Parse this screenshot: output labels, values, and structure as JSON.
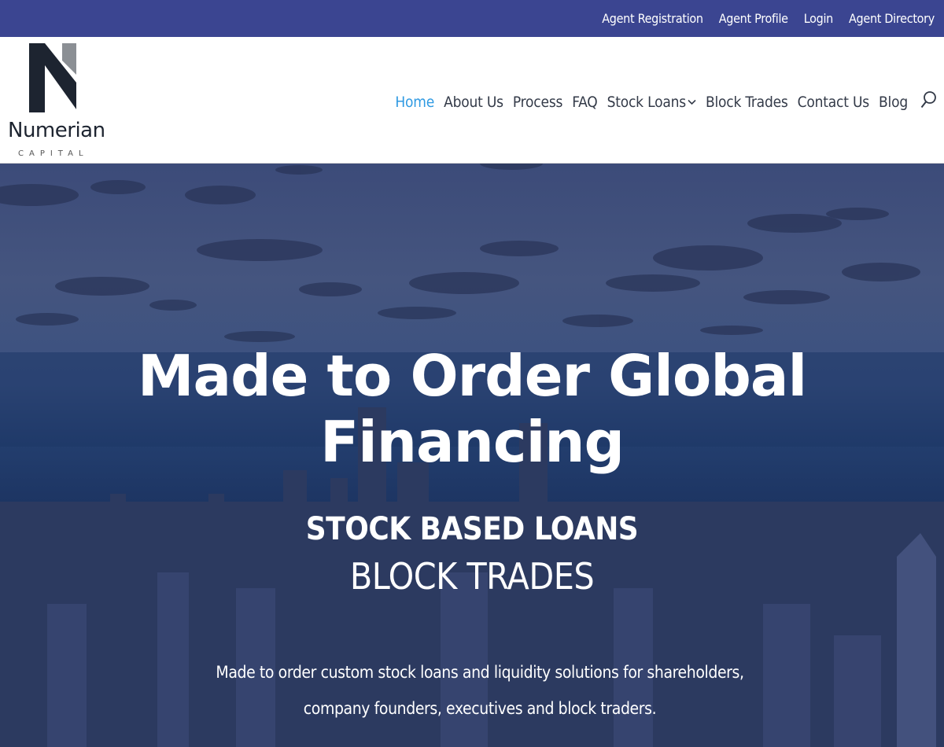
{
  "topbar": {
    "links": [
      "Agent Registration",
      "Agent Profile",
      "Login",
      "Agent Directory"
    ]
  },
  "brand": {
    "name": "Numerian",
    "sub": "CAPITAL"
  },
  "nav": {
    "items": [
      "Home",
      "About Us",
      "Process",
      "FAQ",
      "Stock Loans",
      "Block Trades",
      "Contact Us",
      "Blog"
    ],
    "active": "Home",
    "dropdown_item": "Stock Loans",
    "search_icon": "search-icon"
  },
  "hero": {
    "title": "Made to Order Global Financing",
    "subtitle_1": "STOCK BASED LOANS",
    "subtitle_2": "BLOCK TRADES",
    "description_line_1": "Made to order custom stock loans and liquidity solutions for shareholders,",
    "description_line_2": "company founders, executives and block traders."
  },
  "colors": {
    "topbar": "#3b4591",
    "nav_active": "#2f9ae2",
    "nav_text": "#333a48",
    "hero_overlay": "#2b3d6e"
  }
}
